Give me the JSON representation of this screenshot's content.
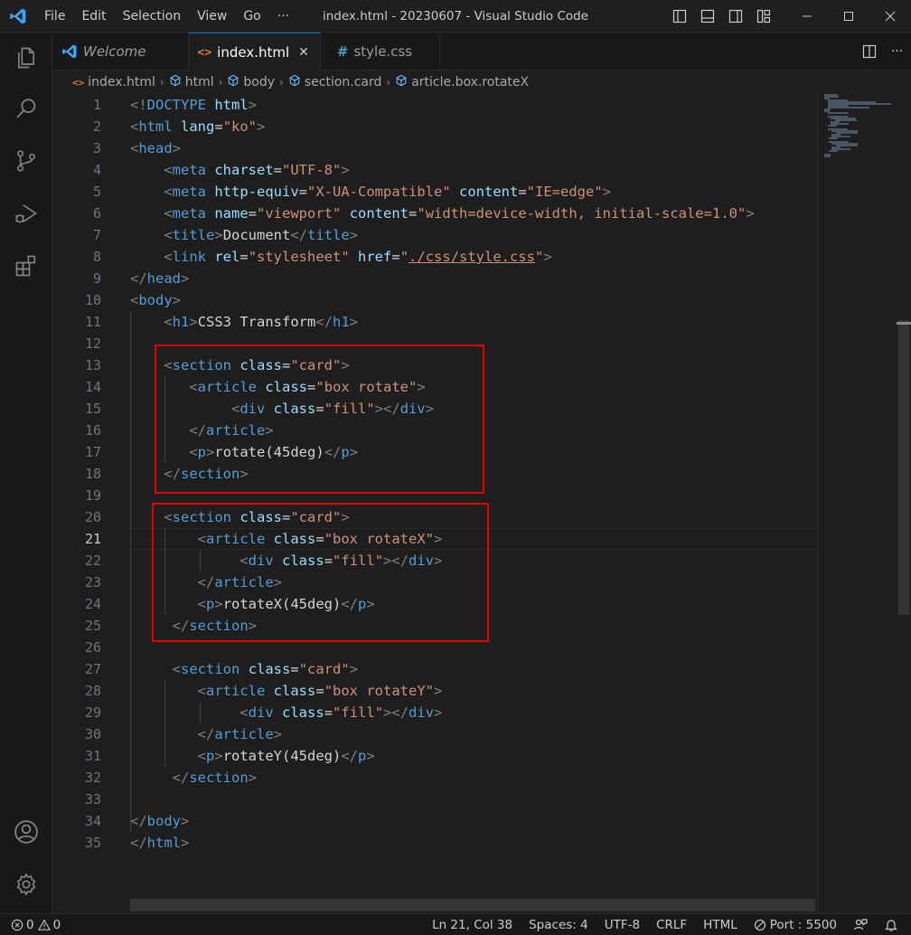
{
  "titlebar": {
    "menu": [
      "File",
      "Edit",
      "Selection",
      "View",
      "Go",
      "···"
    ],
    "title": "index.html - 20230607 - Visual Studio Code"
  },
  "tabs": [
    {
      "label": "Welcome",
      "icon": "vscode-logo-icon",
      "active": false
    },
    {
      "label": "index.html",
      "icon": "html-file-icon",
      "active": true
    },
    {
      "label": "style.css",
      "icon": "css-file-icon",
      "active": false
    }
  ],
  "breadcrumb": [
    "index.html",
    "html",
    "body",
    "section.card",
    "article.box.rotateX"
  ],
  "editor": {
    "current_line": 21,
    "lines": [
      [
        [
          "p",
          "<!"
        ],
        [
          "t",
          "DOCTYPE"
        ],
        [
          "x",
          " "
        ],
        [
          "a",
          "html"
        ],
        [
          "p",
          ">"
        ]
      ],
      [
        [
          "p",
          "<"
        ],
        [
          "t",
          "html"
        ],
        [
          "x",
          " "
        ],
        [
          "a",
          "lang"
        ],
        [
          "x",
          "="
        ],
        [
          "s",
          "\"ko\""
        ],
        [
          "p",
          ">"
        ]
      ],
      [
        [
          "p",
          "<"
        ],
        [
          "t",
          "head"
        ],
        [
          "p",
          ">"
        ]
      ],
      [
        [
          "x",
          "    "
        ],
        [
          "p",
          "<"
        ],
        [
          "t",
          "meta"
        ],
        [
          "x",
          " "
        ],
        [
          "a",
          "charset"
        ],
        [
          "x",
          "="
        ],
        [
          "s",
          "\"UTF-8\""
        ],
        [
          "p",
          ">"
        ]
      ],
      [
        [
          "x",
          "    "
        ],
        [
          "p",
          "<"
        ],
        [
          "t",
          "meta"
        ],
        [
          "x",
          " "
        ],
        [
          "a",
          "http-equiv"
        ],
        [
          "x",
          "="
        ],
        [
          "s",
          "\"X-UA-Compatible\""
        ],
        [
          "x",
          " "
        ],
        [
          "a",
          "content"
        ],
        [
          "x",
          "="
        ],
        [
          "s",
          "\"IE=edge\""
        ],
        [
          "p",
          ">"
        ]
      ],
      [
        [
          "x",
          "    "
        ],
        [
          "p",
          "<"
        ],
        [
          "t",
          "meta"
        ],
        [
          "x",
          " "
        ],
        [
          "a",
          "name"
        ],
        [
          "x",
          "="
        ],
        [
          "s",
          "\"viewport\""
        ],
        [
          "x",
          " "
        ],
        [
          "a",
          "content"
        ],
        [
          "x",
          "="
        ],
        [
          "s",
          "\"width=device-width, initial-scale=1.0\""
        ],
        [
          "p",
          ">"
        ]
      ],
      [
        [
          "x",
          "    "
        ],
        [
          "p",
          "<"
        ],
        [
          "t",
          "title"
        ],
        [
          "p",
          ">"
        ],
        [
          "x",
          "Document"
        ],
        [
          "p",
          "</"
        ],
        [
          "t",
          "title"
        ],
        [
          "p",
          ">"
        ]
      ],
      [
        [
          "x",
          "    "
        ],
        [
          "p",
          "<"
        ],
        [
          "t",
          "link"
        ],
        [
          "x",
          " "
        ],
        [
          "a",
          "rel"
        ],
        [
          "x",
          "="
        ],
        [
          "s",
          "\"stylesheet\""
        ],
        [
          "x",
          " "
        ],
        [
          "a",
          "href"
        ],
        [
          "x",
          "="
        ],
        [
          "s",
          "\""
        ],
        [
          "l",
          "./css/style.css"
        ],
        [
          "s",
          "\""
        ],
        [
          "p",
          ">"
        ]
      ],
      [
        [
          "p",
          "</"
        ],
        [
          "t",
          "head"
        ],
        [
          "p",
          ">"
        ]
      ],
      [
        [
          "p",
          "<"
        ],
        [
          "t",
          "body"
        ],
        [
          "p",
          ">"
        ]
      ],
      [
        [
          "x",
          "    "
        ],
        [
          "p",
          "<"
        ],
        [
          "t",
          "h1"
        ],
        [
          "p",
          ">"
        ],
        [
          "x",
          "CSS3 Transform"
        ],
        [
          "p",
          "</"
        ],
        [
          "t",
          "h1"
        ],
        [
          "p",
          ">"
        ]
      ],
      [],
      [
        [
          "x",
          "    "
        ],
        [
          "p",
          "<"
        ],
        [
          "t",
          "section"
        ],
        [
          "x",
          " "
        ],
        [
          "a",
          "class"
        ],
        [
          "x",
          "="
        ],
        [
          "s",
          "\"card\""
        ],
        [
          "p",
          ">"
        ]
      ],
      [
        [
          "x",
          "       "
        ],
        [
          "p",
          "<"
        ],
        [
          "t",
          "article"
        ],
        [
          "x",
          " "
        ],
        [
          "a",
          "class"
        ],
        [
          "x",
          "="
        ],
        [
          "s",
          "\"box rotate\""
        ],
        [
          "p",
          ">"
        ]
      ],
      [
        [
          "x",
          "            "
        ],
        [
          "p",
          "<"
        ],
        [
          "t",
          "div"
        ],
        [
          "x",
          " "
        ],
        [
          "a",
          "class"
        ],
        [
          "x",
          "="
        ],
        [
          "s",
          "\"fill\""
        ],
        [
          "p",
          "></"
        ],
        [
          "t",
          "div"
        ],
        [
          "p",
          ">"
        ]
      ],
      [
        [
          "x",
          "       "
        ],
        [
          "p",
          "</"
        ],
        [
          "t",
          "article"
        ],
        [
          "p",
          ">"
        ]
      ],
      [
        [
          "x",
          "       "
        ],
        [
          "p",
          "<"
        ],
        [
          "t",
          "p"
        ],
        [
          "p",
          ">"
        ],
        [
          "x",
          "rotate(45deg)"
        ],
        [
          "p",
          "</"
        ],
        [
          "t",
          "p"
        ],
        [
          "p",
          ">"
        ]
      ],
      [
        [
          "x",
          "    "
        ],
        [
          "p",
          "</"
        ],
        [
          "t",
          "section"
        ],
        [
          "p",
          ">"
        ]
      ],
      [],
      [
        [
          "x",
          "    "
        ],
        [
          "p",
          "<"
        ],
        [
          "t",
          "section"
        ],
        [
          "x",
          " "
        ],
        [
          "a",
          "class"
        ],
        [
          "x",
          "="
        ],
        [
          "s",
          "\"card\""
        ],
        [
          "p",
          ">"
        ]
      ],
      [
        [
          "x",
          "        "
        ],
        [
          "p",
          "<"
        ],
        [
          "t",
          "article"
        ],
        [
          "x",
          " "
        ],
        [
          "a",
          "class"
        ],
        [
          "x",
          "="
        ],
        [
          "s",
          "\"box rotateX\""
        ],
        [
          "p",
          ">"
        ]
      ],
      [
        [
          "x",
          "             "
        ],
        [
          "p",
          "<"
        ],
        [
          "t",
          "div"
        ],
        [
          "x",
          " "
        ],
        [
          "a",
          "class"
        ],
        [
          "x",
          "="
        ],
        [
          "s",
          "\"fill\""
        ],
        [
          "p",
          "></"
        ],
        [
          "t",
          "div"
        ],
        [
          "p",
          ">"
        ]
      ],
      [
        [
          "x",
          "        "
        ],
        [
          "p",
          "</"
        ],
        [
          "t",
          "article"
        ],
        [
          "p",
          ">"
        ]
      ],
      [
        [
          "x",
          "        "
        ],
        [
          "p",
          "<"
        ],
        [
          "t",
          "p"
        ],
        [
          "p",
          ">"
        ],
        [
          "x",
          "rotateX(45deg)"
        ],
        [
          "p",
          "</"
        ],
        [
          "t",
          "p"
        ],
        [
          "p",
          ">"
        ]
      ],
      [
        [
          "x",
          "     "
        ],
        [
          "p",
          "</"
        ],
        [
          "t",
          "section"
        ],
        [
          "p",
          ">"
        ]
      ],
      [],
      [
        [
          "x",
          "     "
        ],
        [
          "p",
          "<"
        ],
        [
          "t",
          "section"
        ],
        [
          "x",
          " "
        ],
        [
          "a",
          "class"
        ],
        [
          "x",
          "="
        ],
        [
          "s",
          "\"card\""
        ],
        [
          "p",
          ">"
        ]
      ],
      [
        [
          "x",
          "        "
        ],
        [
          "p",
          "<"
        ],
        [
          "t",
          "article"
        ],
        [
          "x",
          " "
        ],
        [
          "a",
          "class"
        ],
        [
          "x",
          "="
        ],
        [
          "s",
          "\"box rotateY\""
        ],
        [
          "p",
          ">"
        ]
      ],
      [
        [
          "x",
          "             "
        ],
        [
          "p",
          "<"
        ],
        [
          "t",
          "div"
        ],
        [
          "x",
          " "
        ],
        [
          "a",
          "class"
        ],
        [
          "x",
          "="
        ],
        [
          "s",
          "\"fill\""
        ],
        [
          "p",
          "></"
        ],
        [
          "t",
          "div"
        ],
        [
          "p",
          ">"
        ]
      ],
      [
        [
          "x",
          "        "
        ],
        [
          "p",
          "</"
        ],
        [
          "t",
          "article"
        ],
        [
          "p",
          ">"
        ]
      ],
      [
        [
          "x",
          "        "
        ],
        [
          "p",
          "<"
        ],
        [
          "t",
          "p"
        ],
        [
          "p",
          ">"
        ],
        [
          "x",
          "rotateY(45deg)"
        ],
        [
          "p",
          "</"
        ],
        [
          "t",
          "p"
        ],
        [
          "p",
          ">"
        ]
      ],
      [
        [
          "x",
          "     "
        ],
        [
          "p",
          "</"
        ],
        [
          "t",
          "section"
        ],
        [
          "p",
          ">"
        ]
      ],
      [],
      [
        [
          "p",
          "</"
        ],
        [
          "t",
          "body"
        ],
        [
          "p",
          ">"
        ]
      ],
      [
        [
          "p",
          "</"
        ],
        [
          "t",
          "html"
        ],
        [
          "p",
          ">"
        ]
      ]
    ]
  },
  "statusbar": {
    "errors": "0",
    "warnings": "0",
    "position": "Ln 21, Col 38",
    "spaces": "Spaces: 4",
    "encoding": "UTF-8",
    "eol": "CRLF",
    "language": "HTML",
    "port": "Port : 5500"
  },
  "colors": {
    "accent": "#0078d4",
    "highlight_box": "#e00000",
    "tag": "#569cd6",
    "attribute": "#9cdcfe",
    "string": "#ce9178"
  }
}
